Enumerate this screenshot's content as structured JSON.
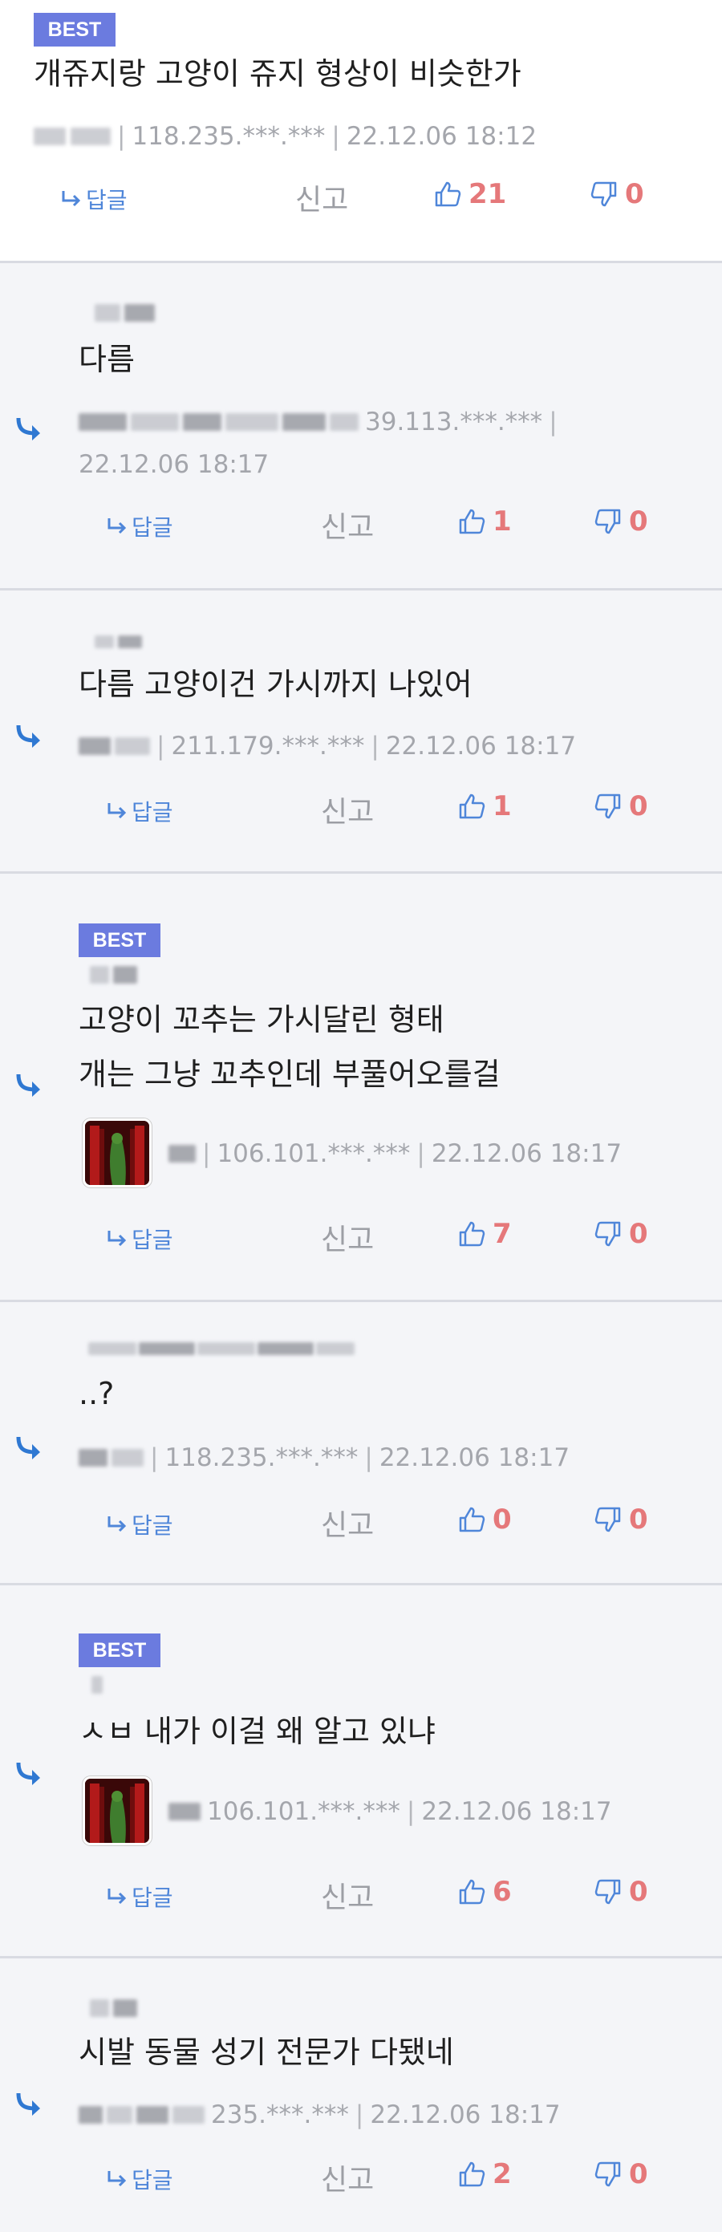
{
  "best_label": "BEST",
  "reply_label": "답글",
  "report_label": "신고",
  "colors": {
    "badge": "#6b7bdf",
    "link": "#4f86d9",
    "count": "#e5787a",
    "meta": "#a4a6ac",
    "reply_bg": "#f4f5f8"
  },
  "icons": {
    "reply": "reply-arrow-icon",
    "up": "thumbs-up-icon",
    "down": "thumbs-down-icon"
  },
  "comments": [
    {
      "best": true,
      "text": "개쥬지랑 고양이 쥬지 형상이 비슷한가",
      "ip": "118.235.***.***",
      "date": "22.12.06 18:12",
      "up": "21",
      "down": "0"
    },
    {
      "text": "다름",
      "ip": "39.113.***.***",
      "date": "22.12.06 18:17",
      "up": "1",
      "down": "0"
    },
    {
      "text": "다름 고양이건 가시까지 나있어",
      "ip": "211.179.***.***",
      "date": "22.12.06 18:17",
      "up": "1",
      "down": "0"
    },
    {
      "best": true,
      "text": "고양이 꼬추는 가시달린 형태",
      "text2": "개는 그냥 꼬추인데 부풀어오를걸",
      "ip": "106.101.***.***",
      "date": "22.12.06 18:17",
      "up": "7",
      "down": "0"
    },
    {
      "text": "..?",
      "ip": "118.235.***.***",
      "date": "22.12.06 18:17",
      "up": "0",
      "down": "0"
    },
    {
      "best": true,
      "text": "ㅅㅂ 내가 이걸 왜 알고 있냐",
      "ip": "106.101.***.***",
      "date": "22.12.06 18:17",
      "up": "6",
      "down": "0"
    },
    {
      "text": "시발 동물 성기 전문가 다됐네",
      "ip": "235.***.***",
      "date": "22.12.06 18:17",
      "up": "2",
      "down": "0"
    }
  ]
}
